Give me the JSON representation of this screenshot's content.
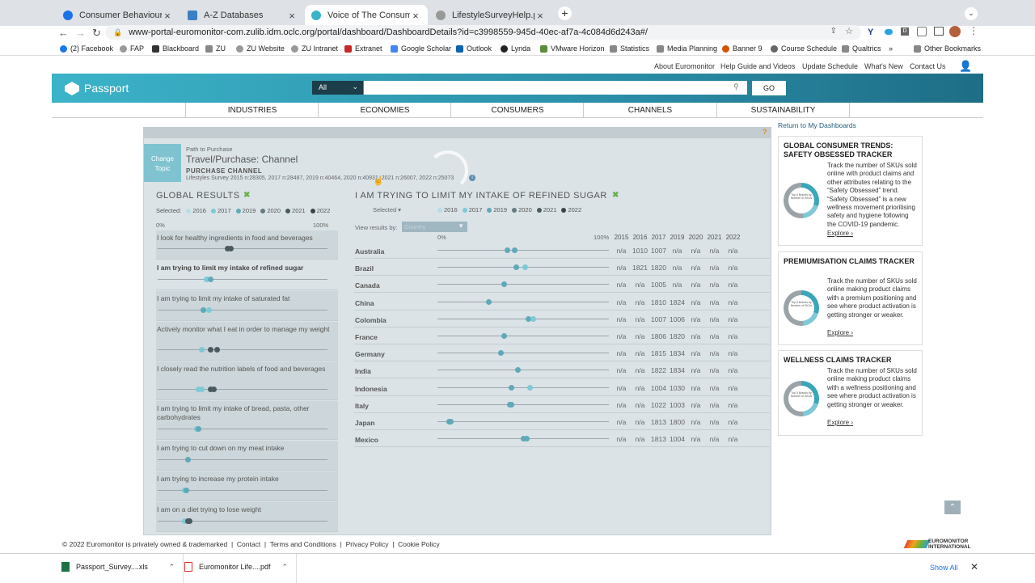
{
  "browser": {
    "tabs": [
      {
        "title": "Consumer Behaviour",
        "active": false
      },
      {
        "title": "A-Z Databases",
        "active": false
      },
      {
        "title": "Voice of The Consumer: Lifesty",
        "active": true
      },
      {
        "title": "LifestyleSurveyHelp.pdf",
        "active": false
      }
    ],
    "new_tab": "+",
    "url": "www-portal-euromonitor-com.zulib.idm.oclc.org/portal/dashboard/DashboardDetails?id=c3998559-945d-40ec-af7a-4c084d6d243a#/",
    "bookmarks": [
      "(2) Facebook",
      "FAP",
      "Blackboard",
      "ZU",
      "ZU Website",
      "ZU Intranet",
      "Extranet",
      "Google Scholar",
      "Outlook",
      "Lynda",
      "VMware Horizon",
      "Statistics",
      "Media Planning",
      "Banner 9",
      "Course Schedule",
      "Qualtrics",
      "»",
      "Other Bookmarks"
    ]
  },
  "site": {
    "util_links": [
      "About Euromonitor",
      "Help Guide and Videos",
      "Update Schedule",
      "What's New",
      "Contact Us"
    ],
    "logo": "Passport",
    "search": {
      "scope": "All",
      "go": "GO",
      "value": ""
    },
    "nav": [
      "INDUSTRIES",
      "ECONOMIES",
      "CONSUMERS",
      "CHANNELS",
      "SUSTAINABILITY"
    ],
    "return_link": "Return to My Dashboards"
  },
  "dashboard": {
    "help": "?",
    "change_topic": "Change Topic",
    "crumb": "Path to Purchase",
    "title": "Travel/Purchase: Channel",
    "subtitle": "PURCHASE CHANNEL",
    "survey_note": "Lifestyles Survey 2015 n:28305, 2017 n:28487, 2019 n:40464, 2020 n:40931, 2021 n:26007, 2022 n:25073",
    "left_title": "GLOBAL RESULTS",
    "selected_label": "Selected:",
    "years": [
      "2016",
      "2017",
      "2019",
      "2020",
      "2021",
      "2022"
    ],
    "year_colors": [
      "#b9dde4",
      "#7ccad6",
      "#5fa9b8",
      "#667a80",
      "#4b5a60",
      "#3b4448"
    ],
    "scale": [
      "0%",
      "100%"
    ],
    "left_rows": [
      {
        "label": "I look for healthy ingredients in food and beverages",
        "bold": false,
        "dots": [
          {
            "v": 41,
            "c": "#4b5a60"
          },
          {
            "v": 43,
            "c": "#4b5a60"
          }
        ]
      },
      {
        "label": "I am trying to limit my intake of refined sugar",
        "bold": true,
        "dots": [
          {
            "v": 29,
            "c": "#7ccad6"
          },
          {
            "v": 31,
            "c": "#5fa9b8"
          }
        ]
      },
      {
        "label": "I am trying to limit my intake of saturated fat",
        "bold": false,
        "dots": [
          {
            "v": 27,
            "c": "#5fa9b8"
          },
          {
            "v": 30,
            "c": "#7ccad6"
          }
        ]
      },
      {
        "label": "Actively monitor what I eat in order to manage my weight",
        "bold": false,
        "dots": [
          {
            "v": 26,
            "c": "#7ccad6"
          },
          {
            "v": 31,
            "c": "#4b5a60"
          },
          {
            "v": 35,
            "c": "#4b5a60"
          }
        ]
      },
      {
        "label": "I closely read the nutrition labels of food and beverages",
        "bold": false,
        "dots": [
          {
            "v": 24,
            "c": "#7ccad6"
          },
          {
            "v": 26,
            "c": "#7ccad6"
          },
          {
            "v": 31,
            "c": "#4b5a60"
          },
          {
            "v": 33,
            "c": "#4b5a60"
          }
        ]
      },
      {
        "label": "I am trying to limit my intake of bread, pasta, other carbohydrates",
        "bold": false,
        "dots": [
          {
            "v": 23,
            "c": "#7ccad6"
          },
          {
            "v": 24,
            "c": "#5fa9b8"
          }
        ]
      },
      {
        "label": "I am trying to cut down on my meat intake",
        "bold": false,
        "dots": [
          {
            "v": 18,
            "c": "#5fa9b8"
          }
        ]
      },
      {
        "label": "I am trying to increase my protein intake",
        "bold": false,
        "dots": [
          {
            "v": 16,
            "c": "#7ccad6"
          },
          {
            "v": 17,
            "c": "#5fa9b8"
          }
        ]
      },
      {
        "label": "I am on a diet trying to lose weight",
        "bold": false,
        "dots": [
          {
            "v": 16,
            "c": "#7ccad6"
          },
          {
            "v": 18,
            "c": "#4b5a60"
          },
          {
            "v": 19,
            "c": "#4b5a60"
          }
        ]
      }
    ],
    "right_title": "I AM TRYING TO LIMIT MY INTAKE OF REFINED SUGAR",
    "right_selected": "Selected",
    "view_by_label": "View results by:",
    "view_by_value": "Country",
    "col_years": [
      "2015",
      "2016",
      "2017",
      "2019",
      "2020",
      "2021",
      "2022"
    ],
    "countries": [
      {
        "name": "Australia",
        "cells": [
          "n/a",
          "1010",
          "1007",
          "n/a",
          "n/a",
          "n/a",
          "n/a"
        ],
        "dots": [
          {
            "v": 41,
            "c": "#5fa9b8"
          },
          {
            "v": 45,
            "c": "#5fa9b8"
          }
        ]
      },
      {
        "name": "Brazil",
        "cells": [
          "n/a",
          "1821",
          "1820",
          "n/a",
          "n/a",
          "n/a",
          "n/a"
        ],
        "dots": [
          {
            "v": 46,
            "c": "#5fa9b8"
          },
          {
            "v": 51,
            "c": "#7ccad6"
          }
        ]
      },
      {
        "name": "Canada",
        "cells": [
          "n/a",
          "n/a",
          "1005",
          "n/a",
          "n/a",
          "n/a",
          "n/a"
        ],
        "dots": [
          {
            "v": 39,
            "c": "#5fa9b8"
          }
        ]
      },
      {
        "name": "China",
        "cells": [
          "n/a",
          "n/a",
          "1810",
          "1824",
          "n/a",
          "n/a",
          "n/a"
        ],
        "dots": [
          {
            "v": 30,
            "c": "#5fa9b8"
          }
        ]
      },
      {
        "name": "Colombia",
        "cells": [
          "n/a",
          "n/a",
          "1007",
          "1006",
          "n/a",
          "n/a",
          "n/a"
        ],
        "dots": [
          {
            "v": 53,
            "c": "#5fa9b8"
          },
          {
            "v": 56,
            "c": "#7ccad6"
          }
        ]
      },
      {
        "name": "France",
        "cells": [
          "n/a",
          "n/a",
          "1806",
          "1820",
          "n/a",
          "n/a",
          "n/a"
        ],
        "dots": [
          {
            "v": 39,
            "c": "#5fa9b8"
          }
        ]
      },
      {
        "name": "Germany",
        "cells": [
          "n/a",
          "n/a",
          "1815",
          "1834",
          "n/a",
          "n/a",
          "n/a"
        ],
        "dots": [
          {
            "v": 37,
            "c": "#5fa9b8"
          }
        ]
      },
      {
        "name": "India",
        "cells": [
          "n/a",
          "n/a",
          "1822",
          "1834",
          "n/a",
          "n/a",
          "n/a"
        ],
        "dots": [
          {
            "v": 47,
            "c": "#5fa9b8"
          }
        ]
      },
      {
        "name": "Indonesia",
        "cells": [
          "n/a",
          "n/a",
          "1004",
          "1030",
          "n/a",
          "n/a",
          "n/a"
        ],
        "dots": [
          {
            "v": 43,
            "c": "#5fa9b8"
          },
          {
            "v": 54,
            "c": "#7ccad6"
          }
        ]
      },
      {
        "name": "Italy",
        "cells": [
          "n/a",
          "n/a",
          "1022",
          "1003",
          "n/a",
          "n/a",
          "n/a"
        ],
        "dots": [
          {
            "v": 42,
            "c": "#5fa9b8"
          },
          {
            "v": 43,
            "c": "#5fa9b8"
          }
        ]
      },
      {
        "name": "Japan",
        "cells": [
          "n/a",
          "n/a",
          "1813",
          "1800",
          "n/a",
          "n/a",
          "n/a"
        ],
        "dots": [
          {
            "v": 7,
            "c": "#5fa9b8"
          },
          {
            "v": 8,
            "c": "#5fa9b8"
          }
        ]
      },
      {
        "name": "Mexico",
        "cells": [
          "n/a",
          "n/a",
          "1813",
          "1004",
          "n/a",
          "n/a",
          "n/a"
        ],
        "dots": [
          {
            "v": 50,
            "c": "#5fa9b8"
          },
          {
            "v": 52,
            "c": "#5fa9b8"
          }
        ]
      }
    ]
  },
  "sidebar_cards": [
    {
      "title": "GLOBAL CONSUMER TRENDS: SAFETY OBSESSED TRACKER",
      "donut_label": "Top 5 Brands by Number of SKUs",
      "text": "Track the number of SKUs sold online with product claims and other attributes relating to the “Safety Obsessed” trend. “Safety Obsessed” is a new wellness movement prioritising safety and hygiene following the COVID-19 pandemic.",
      "link": "Explore ›"
    },
    {
      "title": "PREMIUMISATION CLAIMS TRACKER",
      "donut_label": "Top 5 Brands by Number of SKUs",
      "text": "Track the number of SKUs sold online making product claims with a premium positioning and see where product activation is getting stronger or weaker.",
      "link": "Explore ›"
    },
    {
      "title": "WELLNESS CLAIMS TRACKER",
      "donut_label": "Top 5 Brands by Number of SKUs",
      "text": "Track the number of SKUs sold online making product claims with a wellness positioning and see where product activation is getting stronger or weaker.",
      "link": "Explore ›"
    }
  ],
  "footer": {
    "copyright": "© 2022 Euromonitor is privately owned & trademarked",
    "links": [
      "Contact",
      "Terms and Conditions",
      "Privacy Policy",
      "Cookie Policy"
    ],
    "brand_line1": "EUROMONITOR",
    "brand_line2": "INTERNATIONAL"
  },
  "downloads": {
    "items": [
      "Passport_Survey....xls",
      "Euromonitor Life....pdf"
    ],
    "show_all": "Show All"
  }
}
